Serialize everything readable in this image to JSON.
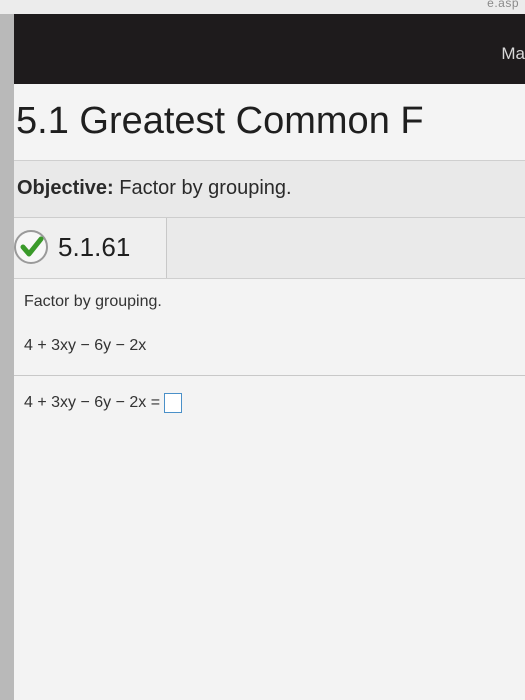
{
  "header": {
    "url_fragment": "e.asp",
    "brand_partial": "Ma"
  },
  "section": {
    "title": "5.1 Greatest Common F"
  },
  "objective": {
    "label": "Objective:",
    "text": "Factor by grouping."
  },
  "problem": {
    "number": "5.1.61",
    "status_icon": "check-icon",
    "status_color": "#3a9a2a"
  },
  "question": {
    "instruction": "Factor by grouping.",
    "expression": "4 + 3xy − 6y − 2x",
    "answer_prefix": "4 + 3xy − 6y − 2x =",
    "answer_value": ""
  }
}
